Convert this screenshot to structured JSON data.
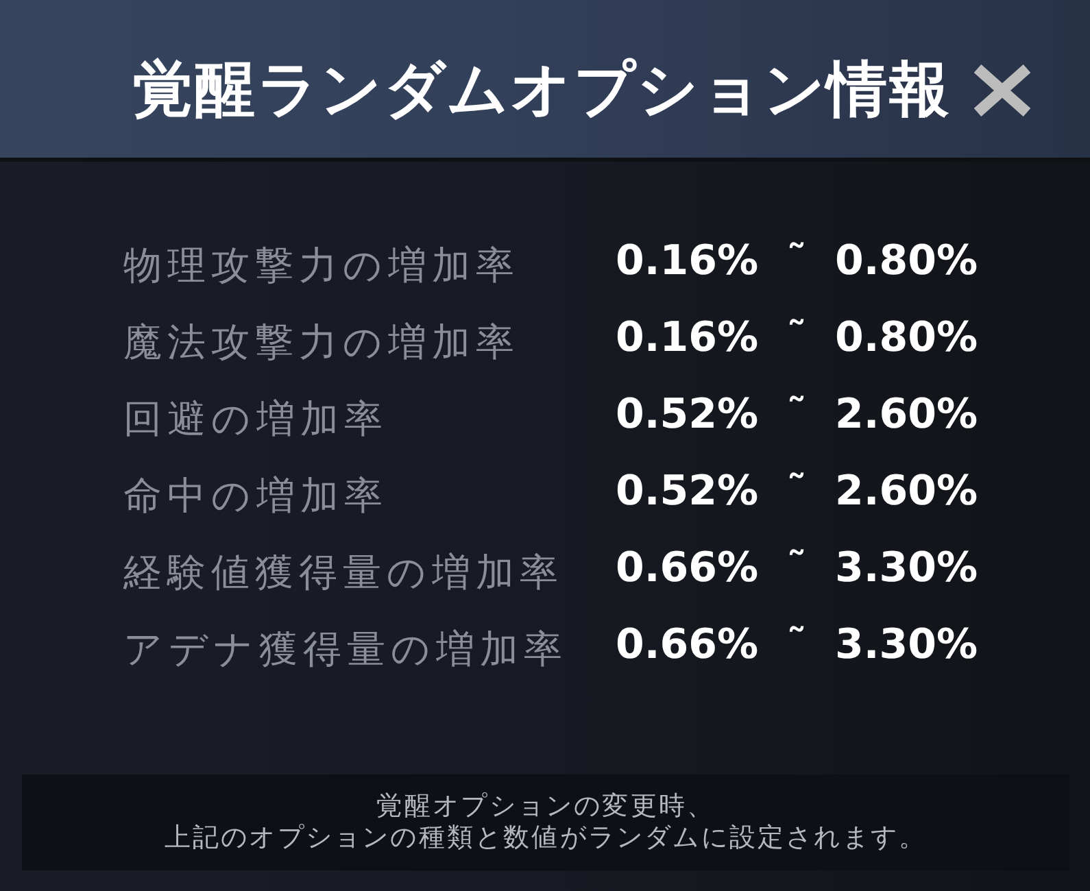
{
  "dialog": {
    "title": "覚醒ランダムオプション情報"
  },
  "options": [
    {
      "name": "物理攻撃力の増加率",
      "range": "0.16% ˜ 0.80%"
    },
    {
      "name": "魔法攻撃力の増加率",
      "range": "0.16% ˜ 0.80%"
    },
    {
      "name": "回避の増加率",
      "range": "0.52% ˜ 2.60%"
    },
    {
      "name": "命中の増加率",
      "range": "0.52% ˜ 2.60%"
    },
    {
      "name": "経験値獲得量の増加率",
      "range": "0.66% ˜ 3.30%"
    },
    {
      "name": "アデナ獲得量の増加率",
      "range": "0.66% ˜ 3.30%"
    }
  ],
  "notice": {
    "lines": [
      "覚醒オプションの変更時、",
      "上記のオプションの種類と数値がランダムに設定されます。"
    ]
  }
}
